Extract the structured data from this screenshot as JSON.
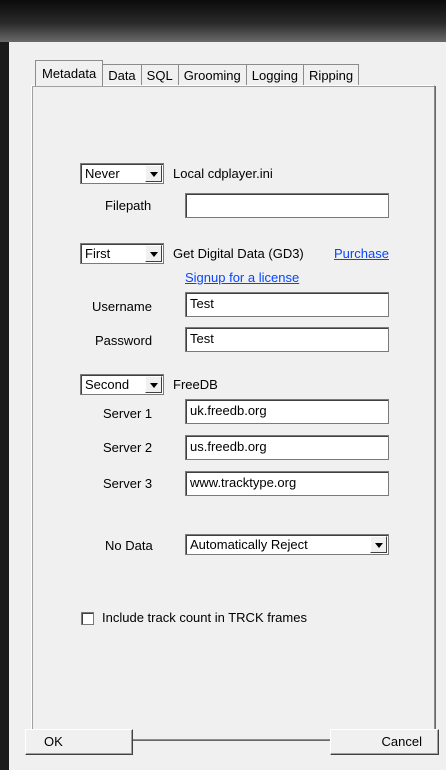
{
  "tabs": [
    "Metadata",
    "Data",
    "SQL",
    "Grooming",
    "Logging",
    "Ripping"
  ],
  "local": {
    "select_value": "Never",
    "label": "Local cdplayer.ini",
    "filepath_label": "Filepath",
    "filepath_value": ""
  },
  "gd3": {
    "select_value": "First",
    "label": "Get Digital Data (GD3)",
    "purchase_link": "Purchase",
    "signup_link": "Signup for a license",
    "username_label": "Username",
    "username_value": "Test",
    "password_label": "Password",
    "password_value": "Test"
  },
  "freedb": {
    "select_value": "Second",
    "label": "FreeDB",
    "server1_label": "Server 1",
    "server1_value": "uk.freedb.org",
    "server2_label": "Server 2",
    "server2_value": "us.freedb.org",
    "server3_label": "Server 3",
    "server3_value": "www.tracktype.org"
  },
  "nodata": {
    "label": "No Data",
    "select_value": "Automatically Reject"
  },
  "track_count": {
    "label": "Include track count in TRCK frames",
    "checked": false
  },
  "buttons": {
    "ok": "OK",
    "cancel": "Cancel"
  }
}
